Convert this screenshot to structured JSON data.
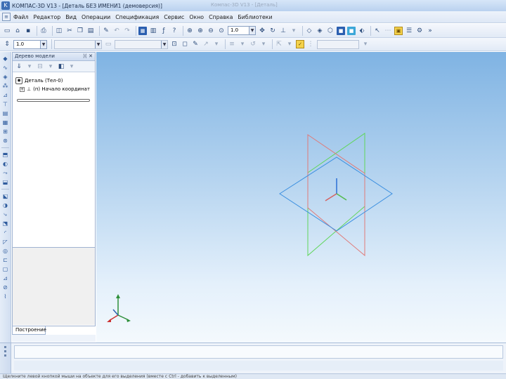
{
  "window": {
    "title": "КОМПАС-3D V13 - [Деталь БЕЗ ИМЕНИ1 (демоверсия)]",
    "title_faint": "Компас-3D V13 - [Деталь]"
  },
  "menu": {
    "items": [
      "Файл",
      "Редактор",
      "Вид",
      "Операции",
      "Спецификация",
      "Сервис",
      "Окно",
      "Справка",
      "Библиотеки"
    ]
  },
  "toolbar": {
    "zoom_value": "1.0"
  },
  "toolbar2": {
    "step_value": "1.0"
  },
  "tree_panel": {
    "title": "Дерево модели",
    "root_label": "Деталь (Тел-0)",
    "child_label": "(п) Начало координат"
  },
  "build_tab": {
    "label": "Построение"
  },
  "status": {
    "text": "Щелкните левой кнопкой мыши на объекте для его выделения (вместе с Ctrl - добавить к выделенным)"
  },
  "colors": {
    "plane_xy": "#3b8fe0",
    "plane_zx": "#e07a78",
    "plane_zy": "#5fd65a",
    "viewport_top": "#7fb3e3"
  }
}
